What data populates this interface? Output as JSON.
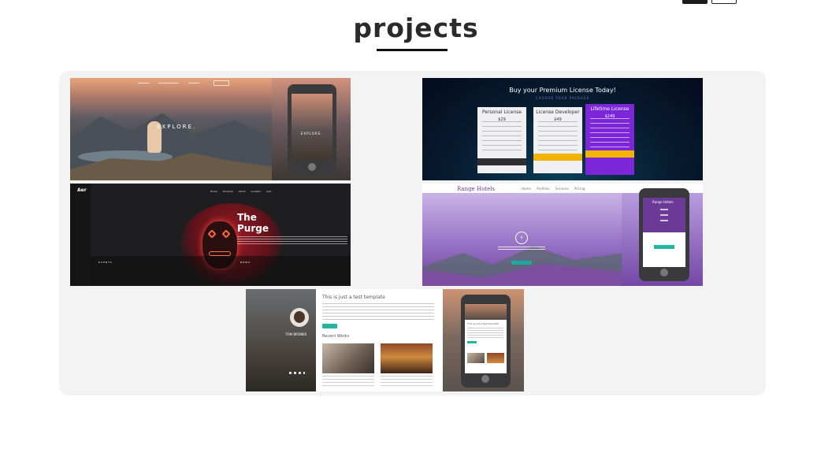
{
  "header": {
    "title": "projects"
  },
  "projects": [
    {
      "name": "explore",
      "overlay_text": "EXPLORE.",
      "phone_text": "EXPLORE."
    },
    {
      "name": "pricing",
      "heading": "Buy your Premium License Today!",
      "subheading": "CHOOSE YOUR PACKAGE",
      "plans": [
        "Personal License",
        "License Developer",
        "Lifetime License"
      ],
      "prices": [
        "$29",
        "$49",
        "$249"
      ]
    },
    {
      "name": "the-purge",
      "logo": "Aer",
      "headline_1": "The",
      "headline_2": "Purge",
      "label_events": "EVENTS",
      "label_news": "NEWS",
      "nav": "Home  Products  About  Location  Cart"
    },
    {
      "name": "range-hotels",
      "logo": "Range Hotels",
      "nav": "Home  Portfolio  Services  Pricing",
      "phone_title": "Range Hotels"
    },
    {
      "name": "blog-template",
      "heading": "This is just a test template",
      "section_title": "Recent Works",
      "author": "TOM BRONER",
      "phone_heading": "This is just a test template"
    }
  ],
  "colors": {
    "title": "#2a2a2a",
    "panel": "#f3f3f3",
    "pricing_personal_footer": "#2f2f33",
    "pricing_developer_footer": "#f2b400",
    "pricing_lifetime": "#7d26d9",
    "teal": "#22b59f"
  }
}
